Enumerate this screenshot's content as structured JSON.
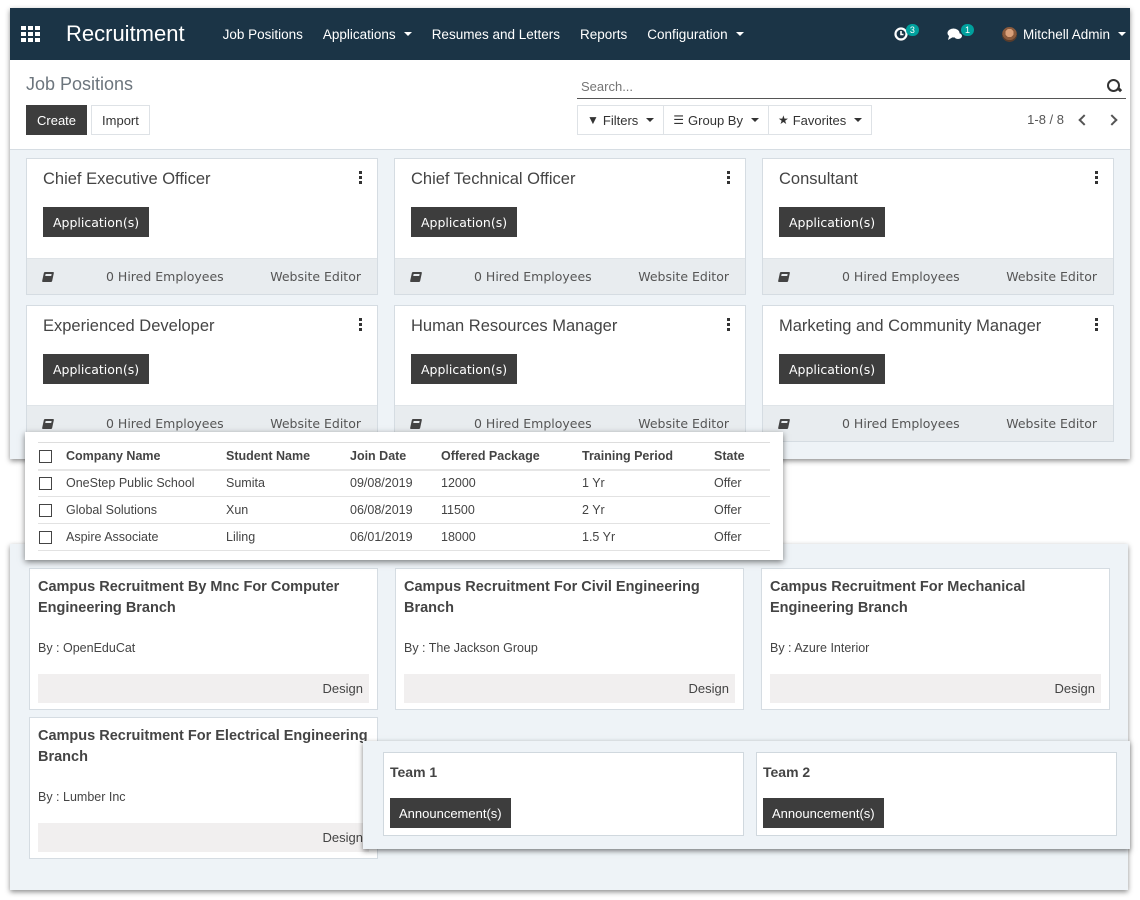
{
  "navbar": {
    "apps_icon": "apps-grid-icon",
    "brand": "Recruitment",
    "menu": [
      {
        "label": "Job Positions",
        "dropdown": false
      },
      {
        "label": "Applications",
        "dropdown": true
      },
      {
        "label": "Resumes and Letters",
        "dropdown": false
      },
      {
        "label": "Reports",
        "dropdown": false
      },
      {
        "label": "Configuration",
        "dropdown": true
      }
    ],
    "activity_count": "3",
    "messages_count": "1",
    "user_name": "Mitchell Admin",
    "badge_color": "#00a09d",
    "bar_color": "#1b3446"
  },
  "control_panel": {
    "breadcrumb": "Job Positions",
    "create_label": "Create",
    "import_label": "Import",
    "search_placeholder": "Search...",
    "filters_label": "Filters",
    "group_by_label": "Group By",
    "favorites_label": "Favorites",
    "pager": "1-8 / 8"
  },
  "job_positions": [
    {
      "title": "Chief Executive Officer",
      "button": "Application(s)",
      "hired": "0 Hired Employees",
      "link": "Website Editor"
    },
    {
      "title": "Chief Technical Officer",
      "button": "Application(s)",
      "hired": "0 Hired Employees",
      "link": "Website Editor"
    },
    {
      "title": "Consultant",
      "button": "Application(s)",
      "hired": "0 Hired Employees",
      "link": "Website Editor"
    },
    {
      "title": "Experienced Developer",
      "button": "Application(s)",
      "hired": "0 Hired Employees",
      "link": "Website Editor"
    },
    {
      "title": "Human Resources Manager",
      "button": "Application(s)",
      "hired": "0 Hired Employees",
      "link": "Website Editor"
    },
    {
      "title": "Marketing and Community Manager",
      "button": "Application(s)",
      "hired": "0 Hired Employees",
      "link": "Website Editor"
    }
  ],
  "placement_table": {
    "columns": [
      "Company Name",
      "Student Name",
      "Join Date",
      "Offered Package",
      "Training Period",
      "State"
    ],
    "rows": [
      [
        "OneStep Public School",
        "Sumita",
        "09/08/2019",
        "12000",
        "1 Yr",
        "Offer"
      ],
      [
        "Global Solutions",
        "Xun",
        "06/08/2019",
        "11500",
        "2 Yr",
        "Offer"
      ],
      [
        "Aspire Associate",
        "Liling",
        "06/01/2019",
        "18000",
        "1.5 Yr",
        "Offer"
      ]
    ]
  },
  "campus_drives": [
    {
      "title": "Campus Recruitment By Mnc For Computer Engineering Branch",
      "by": "By : OpenEduCat",
      "tag": "Design"
    },
    {
      "title": "Campus Recruitment For Civil Engineering Branch",
      "by": "By : The Jackson Group",
      "tag": "Design"
    },
    {
      "title": "Campus Recruitment For Mechanical Engineering Branch",
      "by": "By : Azure Interior",
      "tag": "Design"
    },
    {
      "title": "Campus Recruitment For Electrical Engineering Branch",
      "by": "By : Lumber Inc",
      "tag": "Design"
    }
  ],
  "teams": [
    {
      "title": "Team 1",
      "button": "Announcement(s)"
    },
    {
      "title": "Team 2",
      "button": "Announcement(s)"
    }
  ]
}
